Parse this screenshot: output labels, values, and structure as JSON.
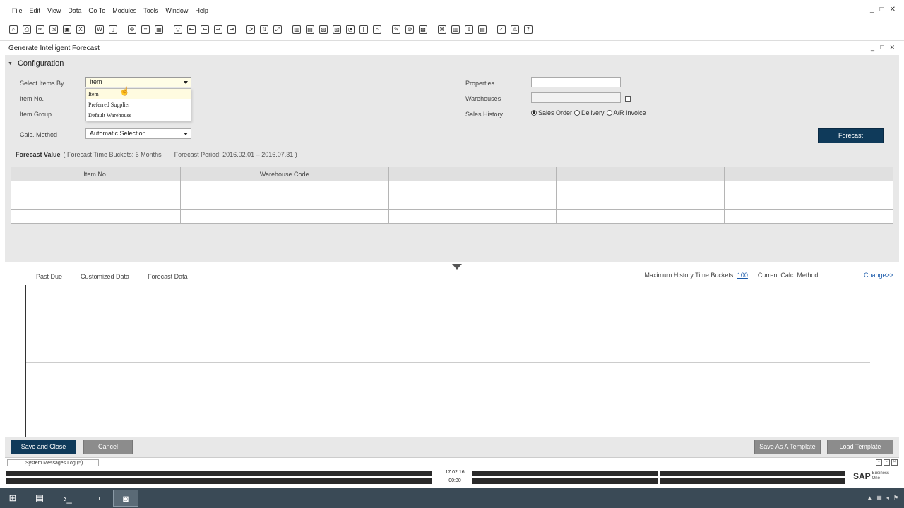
{
  "menubar": {
    "items": [
      "File",
      "Edit",
      "View",
      "Data",
      "Go To",
      "Modules",
      "Tools",
      "Window",
      "Help"
    ],
    "controls": [
      "_",
      "□",
      "✕"
    ]
  },
  "toolbar": {
    "icon_names": [
      "find-icon",
      "print-icon",
      "email-icon",
      "export-icon",
      "preview-icon",
      "excel-icon",
      "word-icon",
      "pdf-icon",
      "move-icon",
      "layout-icon",
      "form-settings-icon",
      "filter-icon",
      "first-record-icon",
      "previous-record-icon",
      "next-record-icon",
      "last-record-icon",
      "refresh-icon",
      "sort-icon",
      "resize-icon",
      "copy-from-icon",
      "copy-to-icon",
      "base-document-icon",
      "target-document-icon",
      "gross-profit-icon",
      "columns-icon",
      "lookup-icon",
      "edit-icon",
      "settings-icon",
      "messages-icon",
      "relationship-icon",
      "docs-icon",
      "approval-icon",
      "transaction-icon",
      "journal-icon",
      "alerts-icon",
      "help-icon"
    ]
  },
  "form": {
    "title": "Generate Intelligent Forecast",
    "controls": [
      "_",
      "□",
      "✕"
    ],
    "section_title": "Configuration",
    "labels": {
      "select_items_by": "Select Items By",
      "item_no": "Item No.",
      "item_group": "Item Group",
      "calc_method": "Calc. Method",
      "properties": "Properties",
      "warehouses": "Warehouses",
      "sales_history": "Sales History"
    },
    "select_items_by_value": "Item",
    "dropdown_options": [
      "Item",
      "Preferred Supplier",
      "Default Warehouse"
    ],
    "calc_method_value": "Automatic Selection",
    "properties_value": "",
    "warehouses_value": "",
    "sales_history_options": [
      {
        "label": "Sales Order",
        "selected": true
      },
      {
        "label": "Delivery",
        "selected": false
      },
      {
        "label": "A/R Invoice",
        "selected": false
      }
    ],
    "forecast_button": "Forecast",
    "forecast_value_title": "Forecast Value",
    "forecast_time_buckets": "( Forecast Time Buckets: 6 Months",
    "forecast_period": "Forecast Period: 2016.02.01 – 2016.07.31 )",
    "grid_headers": [
      "Item No.",
      "Warehouse Code",
      "",
      "",
      ""
    ],
    "grid_rows": 3
  },
  "chart": {
    "legend": [
      {
        "label": "Past Due",
        "color": "#1a8a9a",
        "style": "solid"
      },
      {
        "label": "Customized Data",
        "color": "#1a5a9a",
        "style": "dashed"
      },
      {
        "label": "Forecast Data",
        "color": "#8a7a20",
        "style": "solid"
      }
    ],
    "max_history_label": "Maximum History Time Buckets:",
    "max_history_value": "100",
    "current_calc_label": "Current Calc. Method:",
    "change_link": "Change>>"
  },
  "footer": {
    "save_close": "Save and Close",
    "cancel": "Cancel",
    "save_template": "Save As A Template",
    "load_template": "Load Template"
  },
  "system_messages": {
    "tab_label": "System Messages Log (5)"
  },
  "statusbar": {
    "date": "17.02.16",
    "time": "00:30",
    "brand": "SAP",
    "brand_sub_1": "Business",
    "brand_sub_2": "One"
  },
  "colors": {
    "primary_button": "#0f3a5a",
    "secondary_button": "#8c8c8c",
    "form_background": "#e8e8e8",
    "taskbar": "#3a4a56"
  }
}
